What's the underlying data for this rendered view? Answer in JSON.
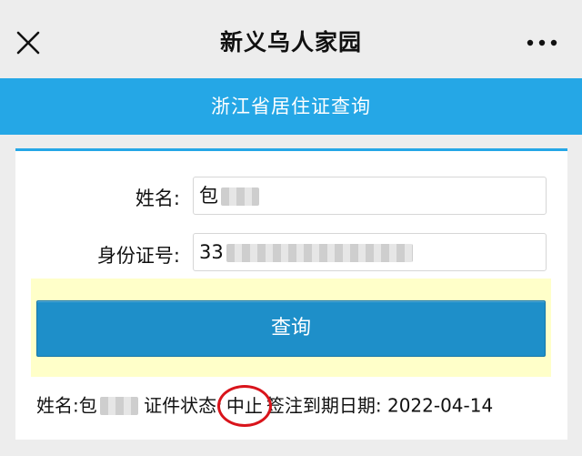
{
  "titlebar": {
    "close_icon": "close-icon",
    "title": "新义乌人家园",
    "more_icon": "more-dots-icon"
  },
  "banner": {
    "text": "浙江省居住证查询"
  },
  "form": {
    "name_label": "姓名:",
    "name_value": "包",
    "id_label": "身份证号:",
    "id_value": "33"
  },
  "query_button": {
    "label": "查询"
  },
  "result": {
    "name_prefix": "姓名:包",
    "status_label": "证件状态:",
    "status_value": "中止",
    "expiry_label": "签注到期日期:",
    "expiry_value": "2022-04-14"
  },
  "colors": {
    "banner": "#25a7e6",
    "button": "#1e8fc9",
    "highlight": "#ffffc9",
    "circle": "#d9141b"
  }
}
